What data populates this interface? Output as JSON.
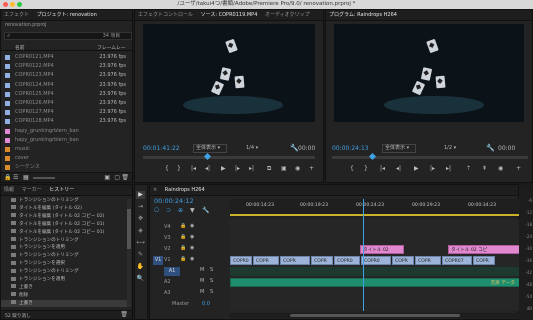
{
  "window": {
    "title": "/ユーザ/takui4つ/書類/Adobe/Premiere Pro/9.0/ renovation.prproj *"
  },
  "project_panel": {
    "tabs": [
      "エフェクト",
      "プロジェクト: renovation"
    ],
    "file_name": "renovation.prproj",
    "item_count": "34 項目",
    "col_name": "名前",
    "col_fps": "フレームレー",
    "items": [
      {
        "name": "COPR0121.MP4",
        "fps": "23.976 fps",
        "color": "#8fb0e0"
      },
      {
        "name": "COPR0122.MP4",
        "fps": "23.976 fps",
        "color": "#8fb0e0"
      },
      {
        "name": "COPR0123.MP4",
        "fps": "23.976 fps",
        "color": "#8fb0e0"
      },
      {
        "name": "COPR0124.MP4",
        "fps": "23.976 fps",
        "color": "#8fb0e0"
      },
      {
        "name": "COPR0125.MP4",
        "fps": "23.976 fps",
        "color": "#8fb0e0"
      },
      {
        "name": "COPR0126.MP4",
        "fps": "23.976 fps",
        "color": "#8fb0e0"
      },
      {
        "name": "COPR0127.MP4",
        "fps": "23.976 fps",
        "color": "#8fb0e0"
      },
      {
        "name": "COPR0128.MP4",
        "fps": "23.976 fps",
        "color": "#8fb0e0"
      },
      {
        "name": "hapy_grunkingrblern_ban",
        "fps": "",
        "color": "#e08ad4"
      },
      {
        "name": "hapy_grunkingrblern_ban",
        "fps": "",
        "color": "#e08ad4"
      },
      {
        "name": "music",
        "fps": "",
        "color": "#d98a2a"
      },
      {
        "name": "cover",
        "fps": "",
        "color": "#d98a2a"
      },
      {
        "name": "シーケンス",
        "fps": "",
        "color": "#d98a2a"
      }
    ]
  },
  "history_panel": {
    "tabs": [
      "情報",
      "マーカー",
      "ヒストリー"
    ],
    "items": [
      "トランジションのトリミング",
      "タイトルを編集 (タイトル 02)",
      "タイトルを編集 (タイトル 02 コピー 02)",
      "タイトルを編集 (タイトル 02 コピー 01)",
      "タイトルを編集 (タイトル 02 コピー 01)",
      "トランジションのトリミング",
      "トランジションを適用",
      "トランジションのトリミング",
      "トランジションを選択",
      "トランジションのトリミング",
      "トランジションを適用",
      "上書き",
      "削除",
      "上書き"
    ],
    "selected_index": 13,
    "footer": "52 取り消し"
  },
  "source_monitor": {
    "tabs": [
      "エフェクトコントロール",
      "ソース: COPR0119.MP4",
      "オーディオクリップ"
    ],
    "timecode": "00:01:41:22",
    "fit": "全体表示",
    "resolution": "1/4",
    "end_time": "00:00"
  },
  "program_monitor": {
    "tabs": [
      "プログラム: Raindrops H264"
    ],
    "timecode": "00:00:24:13",
    "fit": "全体表示",
    "resolution": "1/2",
    "end_time": "00:00"
  },
  "timeline": {
    "tab": "Raindrops H264",
    "current_time": "00:00:24:12",
    "ruler": [
      "00:00:14:23",
      "00:00:19:23",
      "00:00:24:23",
      "00:00:29:23",
      "00:00:34:23"
    ],
    "tracks": [
      "V4",
      "V3",
      "V2",
      "V1",
      "A1",
      "A2",
      "A3",
      "Master"
    ],
    "master_value": "0.0",
    "v1_clips": [
      "COPR0",
      "COPR",
      "COPR",
      "COPR",
      "COPR0",
      "COPR0",
      "COPR",
      "COPR",
      "COPR07",
      "COPR"
    ],
    "title_clips": [
      "タイトル 02",
      "タイトル 02 コピ"
    ],
    "audio_label": "音楽 データ"
  },
  "vu_meter": {
    "labels": [
      "-6",
      "-12",
      "-18",
      "-24",
      "-30",
      "-36",
      "-42",
      "-48",
      "-54",
      "dB"
    ]
  },
  "tools": [
    "▶",
    "⇥",
    "✥",
    "◈",
    "⟷",
    "✎",
    "✋",
    "🔍"
  ]
}
